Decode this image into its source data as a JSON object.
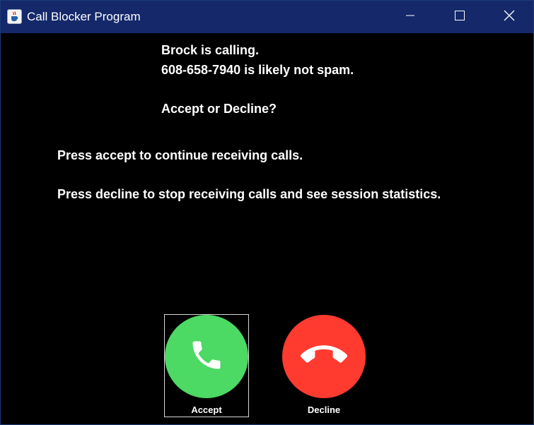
{
  "window": {
    "title": "Call Blocker Program",
    "app_icon": "java-cup-icon",
    "controls": [
      "minimize-icon",
      "maximize-icon",
      "close-icon"
    ]
  },
  "call": {
    "caller_line": "Brock is calling.",
    "number_line": "608-658-7940 is likely not spam.",
    "prompt": "Accept or Decline?",
    "accept_info": "Press accept to continue receiving calls.",
    "decline_info": "Press decline to stop receiving calls and see session statistics."
  },
  "buttons": {
    "accept": {
      "label": "Accept",
      "icon": "phone-icon",
      "color": "#4cd964"
    },
    "decline": {
      "label": "Decline",
      "icon": "hang-up-icon",
      "color": "#ff3b30"
    }
  },
  "colors": {
    "titlebar": "#14286a",
    "background": "#000000",
    "text": "#ffffff"
  }
}
